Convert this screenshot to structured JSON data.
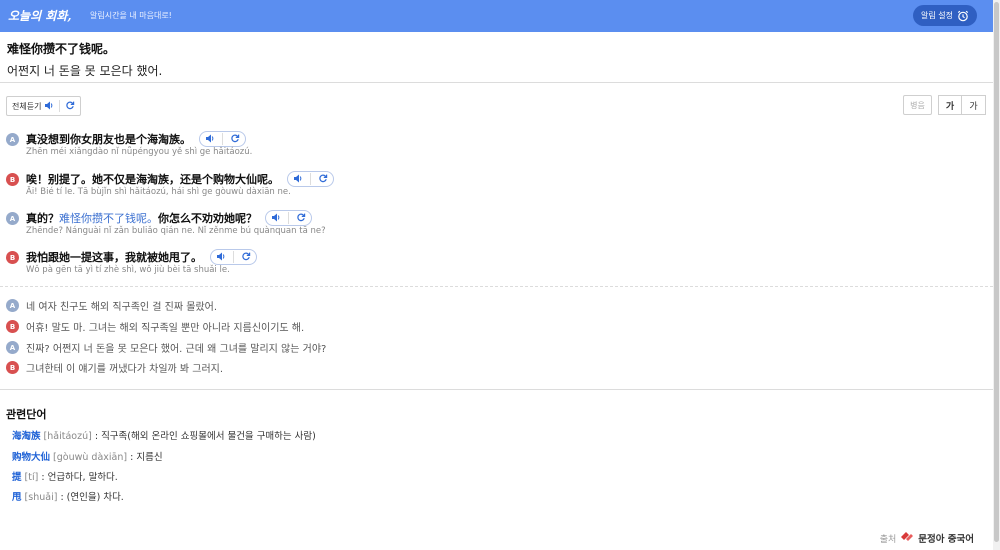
{
  "header": {
    "brand": "오늘의 회화,",
    "tagline": "알림시간을 내 마음대로!",
    "alarm_label": "알림 설정"
  },
  "headline": {
    "zh": "难怪你攒不了钱呢。",
    "ko": "어쩐지 너 돈을 못 모은다 했어."
  },
  "toolbar": {
    "play_all_label": "전체듣기",
    "pinyin_label": "병음",
    "font_large": "가",
    "font_small": "가"
  },
  "dialogue": [
    {
      "speaker": "A",
      "zh_before": "真没想到你女朋友也是个海淘族。",
      "zh_highlight": "",
      "zh_after": "",
      "pinyin": "Zhēn méi xiǎngdào nǐ nǚpéngyou yě shì ge hǎitáozú."
    },
    {
      "speaker": "B",
      "zh_before": "唉！别提了。她不仅是海淘族，还是个购物大仙呢。",
      "zh_highlight": "",
      "zh_after": "",
      "pinyin": "Āi! Bié tí le. Tā bùjǐn shì hǎitáozú, hái shì ge gòuwù dàxiān ne."
    },
    {
      "speaker": "A",
      "zh_before": "真的？",
      "zh_highlight": "难怪你攒不了钱呢。",
      "zh_after": "你怎么不劝劝她呢？",
      "pinyin": "Zhēnde? Nánguài nǐ zǎn buliǎo qián ne. Nǐ zěnme bú quànquan tā ne?"
    },
    {
      "speaker": "B",
      "zh_before": "我怕跟她一提这事，我就被她甩了。",
      "zh_highlight": "",
      "zh_after": "",
      "pinyin": "Wǒ pà gēn tā yì tí zhè shì, wǒ jiù bèi tā shuǎi le."
    }
  ],
  "translation": [
    {
      "speaker": "A",
      "text": "네 여자 친구도 해외 직구족인 걸 진짜 몰랐어."
    },
    {
      "speaker": "B",
      "text": "어휴! 말도 마. 그녀는 해외 직구족일 뿐만 아니라 지름신이기도 해."
    },
    {
      "speaker": "A",
      "text": "진짜? 어쩐지 너 돈을 못 모은다 했어. 근데 왜 그녀를 말리지 않는 거야?"
    },
    {
      "speaker": "B",
      "text": "그녀한테 이 얘기를 꺼냈다가 차일까 봐 그러지."
    }
  ],
  "vocab": {
    "title": "관련단어",
    "items": [
      {
        "word": "海淘族",
        "pinyin": "[hǎitáozú]",
        "meaning": ": 직구족(해외 온라인 쇼핑몰에서 물건을 구매하는 사람)"
      },
      {
        "word": "购物大仙",
        "pinyin": "[gòuwù dàxiān]",
        "meaning": ": 지름신"
      },
      {
        "word": "提",
        "pinyin": "[tí]",
        "meaning": ": 언급하다, 말하다."
      },
      {
        "word": "甩",
        "pinyin": "[shuǎi]",
        "meaning": ": (연인을) 차다."
      }
    ]
  },
  "source": {
    "label": "출처",
    "publisher": "문정아 중국어"
  },
  "colors": {
    "topbar": "#5b8ef0",
    "speaker_a": "#95aacb",
    "speaker_b": "#d85050",
    "highlight": "#3a6fd0"
  },
  "icons": [
    "alarm-clock-icon",
    "speaker-icon",
    "repeat-icon",
    "source-logo-icon"
  ]
}
